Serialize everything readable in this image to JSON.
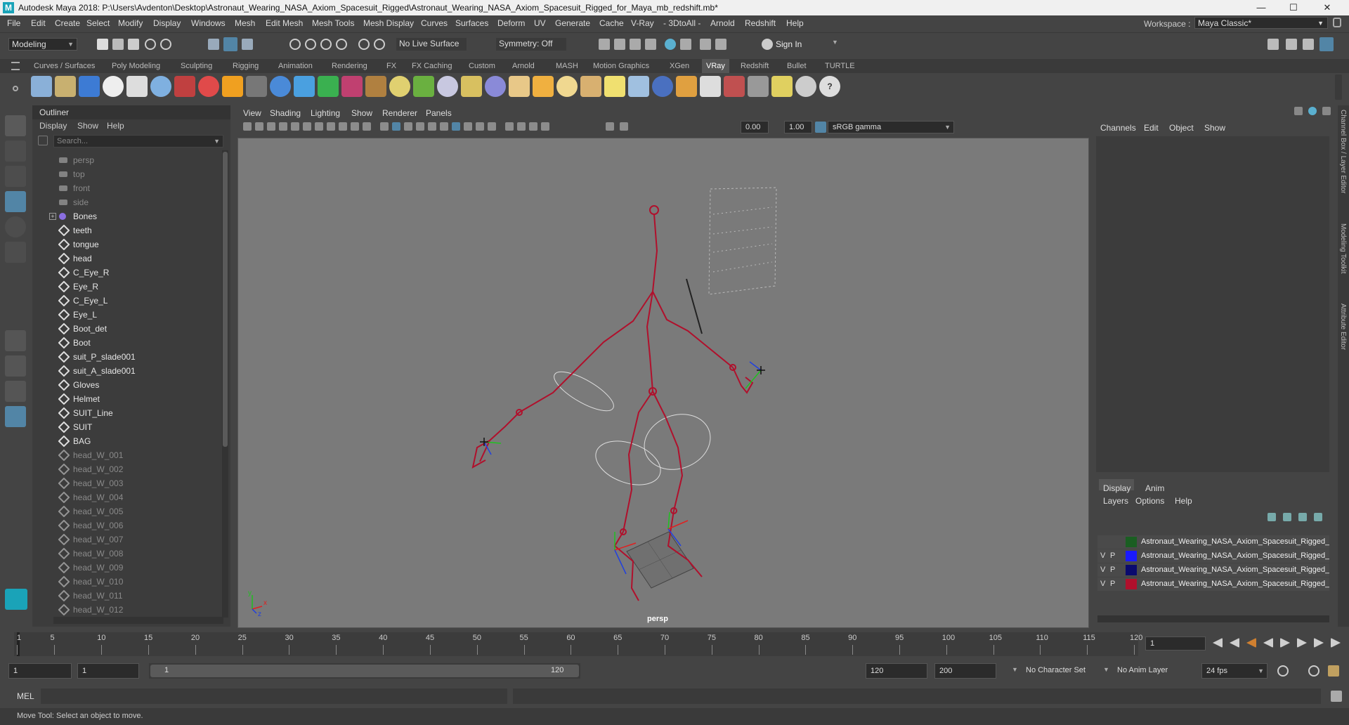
{
  "window": {
    "title": "Autodesk Maya 2018: P:\\Users\\Avdenton\\Desktop\\Astronaut_Wearing_NASA_Axiom_Spacesuit_Rigged\\Astronaut_Wearing_NASA_Axiom_Spacesuit_Rigged_for_Maya_mb_redshift.mb*",
    "minimize": "—",
    "maximize": "☐",
    "close": "✕"
  },
  "menubar": {
    "items": [
      "File",
      "Edit",
      "Create",
      "Select",
      "Modify",
      "Display",
      "Windows",
      "Mesh",
      "Edit Mesh",
      "Mesh Tools",
      "Mesh Display",
      "Curves",
      "Surfaces",
      "Deform",
      "UV",
      "Generate",
      "Cache",
      "V-Ray",
      "- 3DtoAll -",
      "Arnold",
      "Redshift",
      "Help"
    ],
    "workspace_label": "Workspace :",
    "workspace_value": "Maya Classic*"
  },
  "statusline": {
    "menuset": "Modeling",
    "live_surface": "No Live Surface",
    "symmetry": "Symmetry: Off",
    "sign_in": "Sign In"
  },
  "shelf": {
    "tabs": [
      "Curves / Surfaces",
      "Poly Modeling",
      "Sculpting",
      "Rigging",
      "Animation",
      "Rendering",
      "FX",
      "FX Caching",
      "Custom",
      "Arnold",
      "MASH",
      "Motion Graphics",
      "XGen",
      "VRay",
      "Redshift",
      "Bullet",
      "TURTLE"
    ],
    "active_tab": "VRay"
  },
  "outliner": {
    "title": "Outliner",
    "menu": [
      "Display",
      "Show",
      "Help"
    ],
    "search_placeholder": "Search...",
    "items": [
      {
        "label": "persp",
        "type": "camera",
        "dim": true
      },
      {
        "label": "top",
        "type": "camera",
        "dim": true
      },
      {
        "label": "front",
        "type": "camera",
        "dim": true
      },
      {
        "label": "side",
        "type": "camera",
        "dim": true
      },
      {
        "label": "Bones",
        "type": "joint",
        "dim": false,
        "expand": "+"
      },
      {
        "label": "teeth",
        "type": "mesh",
        "dim": false
      },
      {
        "label": "tongue",
        "type": "mesh",
        "dim": false
      },
      {
        "label": "head",
        "type": "mesh",
        "dim": false
      },
      {
        "label": "C_Eye_R",
        "type": "mesh",
        "dim": false
      },
      {
        "label": "Eye_R",
        "type": "mesh",
        "dim": false
      },
      {
        "label": "C_Eye_L",
        "type": "mesh",
        "dim": false
      },
      {
        "label": "Eye_L",
        "type": "mesh",
        "dim": false
      },
      {
        "label": "Boot_det",
        "type": "mesh",
        "dim": false
      },
      {
        "label": "Boot",
        "type": "mesh",
        "dim": false
      },
      {
        "label": "suit_P_slade001",
        "type": "mesh",
        "dim": false
      },
      {
        "label": "suit_A_slade001",
        "type": "mesh",
        "dim": false
      },
      {
        "label": "Gloves",
        "type": "mesh",
        "dim": false
      },
      {
        "label": "Helmet",
        "type": "mesh",
        "dim": false
      },
      {
        "label": "SUIT_Line",
        "type": "mesh",
        "dim": false
      },
      {
        "label": "SUIT",
        "type": "mesh",
        "dim": false
      },
      {
        "label": "BAG",
        "type": "mesh",
        "dim": false
      },
      {
        "label": "head_W_001",
        "type": "mesh",
        "dim": true
      },
      {
        "label": "head_W_002",
        "type": "mesh",
        "dim": true
      },
      {
        "label": "head_W_003",
        "type": "mesh",
        "dim": true
      },
      {
        "label": "head_W_004",
        "type": "mesh",
        "dim": true
      },
      {
        "label": "head_W_005",
        "type": "mesh",
        "dim": true
      },
      {
        "label": "head_W_006",
        "type": "mesh",
        "dim": true
      },
      {
        "label": "head_W_007",
        "type": "mesh",
        "dim": true
      },
      {
        "label": "head_W_008",
        "type": "mesh",
        "dim": true
      },
      {
        "label": "head_W_009",
        "type": "mesh",
        "dim": true
      },
      {
        "label": "head_W_010",
        "type": "mesh",
        "dim": true
      },
      {
        "label": "head_W_011",
        "type": "mesh",
        "dim": true
      },
      {
        "label": "head_W_012",
        "type": "mesh",
        "dim": true
      }
    ]
  },
  "viewport": {
    "menu": [
      "View",
      "Shading",
      "Lighting",
      "Show",
      "Renderer",
      "Panels"
    ],
    "field_a": "0.00",
    "field_b": "1.00",
    "color_space": "sRGB gamma",
    "camera": "persp",
    "axis_labels": {
      "x": "x",
      "y": "y",
      "z": "z"
    }
  },
  "channelbox": {
    "menu": [
      "Channels",
      "Edit",
      "Object",
      "Show"
    ],
    "layer_tabs": [
      "Display",
      "Anim"
    ],
    "layer_menu": [
      "Layers",
      "Options",
      "Help"
    ],
    "layers": [
      {
        "v": "",
        "p": "",
        "color": "#1a5e22",
        "name": "Astronaut_Wearing_NASA_Axiom_Spacesuit_Rigged_C"
      },
      {
        "v": "V",
        "p": "P",
        "color": "#1a1aff",
        "name": "Astronaut_Wearing_NASA_Axiom_Spacesuit_Rigged_C"
      },
      {
        "v": "V",
        "p": "P",
        "color": "#0a0a6e",
        "name": "Astronaut_Wearing_NASA_Axiom_Spacesuit_Rigged_H"
      },
      {
        "v": "V",
        "p": "P",
        "color": "#b0102c",
        "name": "Astronaut_Wearing_NASA_Axiom_Spacesuit_Rigged_B"
      }
    ],
    "side_tabs": [
      "Channel Box / Layer Editor",
      "Modeling Toolkit",
      "Attribute Editor"
    ]
  },
  "timeline": {
    "ticks": [
      "1",
      "5",
      "10",
      "15",
      "20",
      "25",
      "30",
      "35",
      "40",
      "45",
      "50",
      "55",
      "60",
      "65",
      "70",
      "75",
      "80",
      "85",
      "90",
      "95",
      "100",
      "105",
      "110",
      "115",
      "120"
    ],
    "current_frame": "1"
  },
  "range": {
    "start": "1",
    "playback_start": "1",
    "slider_start": "1",
    "slider_end": "120",
    "playback_end": "120",
    "end": "200",
    "character_set": "No Character Set",
    "anim_layer": "No Anim Layer",
    "fps": "24 fps"
  },
  "cmdline": {
    "label": "MEL"
  },
  "helpline": {
    "text": "Move Tool: Select an object to move."
  },
  "colors": {
    "accent": "#5285a6",
    "rig": "#b0102c",
    "viewport_bg": "#7a7a7a"
  }
}
